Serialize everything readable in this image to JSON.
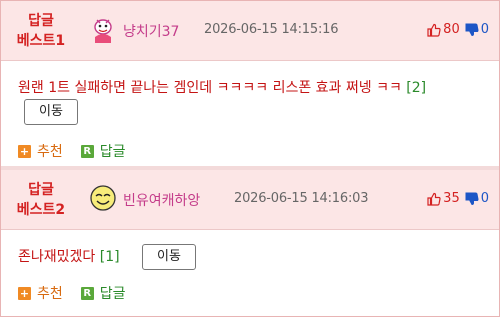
{
  "posts": [
    {
      "rank_line1": "답글",
      "rank_line2": "베스트1",
      "nickname": "냥치기37",
      "timestamp": "2026-06-15 14:15:16",
      "upvotes": "80",
      "downvotes": "0",
      "content": "원랜 1트 실패하면 끝나는 겜인데 ㅋㅋㅋㅋ 리스폰 효과 쩌넹 ㅋㅋ",
      "reply_count": "[2]",
      "move_label": "이동",
      "recommend_label": "추천",
      "reply_label": "답글",
      "avatar_icon": "cartoon-character-icon"
    },
    {
      "rank_line1": "답글",
      "rank_line2": "베스트2",
      "nickname": "빈유여캐하앙",
      "timestamp": "2026-06-15 14:16:03",
      "upvotes": "35",
      "downvotes": "0",
      "content": "존나재밌겠다",
      "reply_count": "[1]",
      "move_label": "이동",
      "recommend_label": "추천",
      "reply_label": "답글",
      "avatar_icon": "smiley-face-icon"
    }
  ],
  "colors": {
    "accent_red": "#d42222",
    "header_bg": "#fce6e6",
    "nick_pink": "#c43c8a",
    "down_blue": "#1d56c6",
    "count_green": "#2a8a2a"
  }
}
